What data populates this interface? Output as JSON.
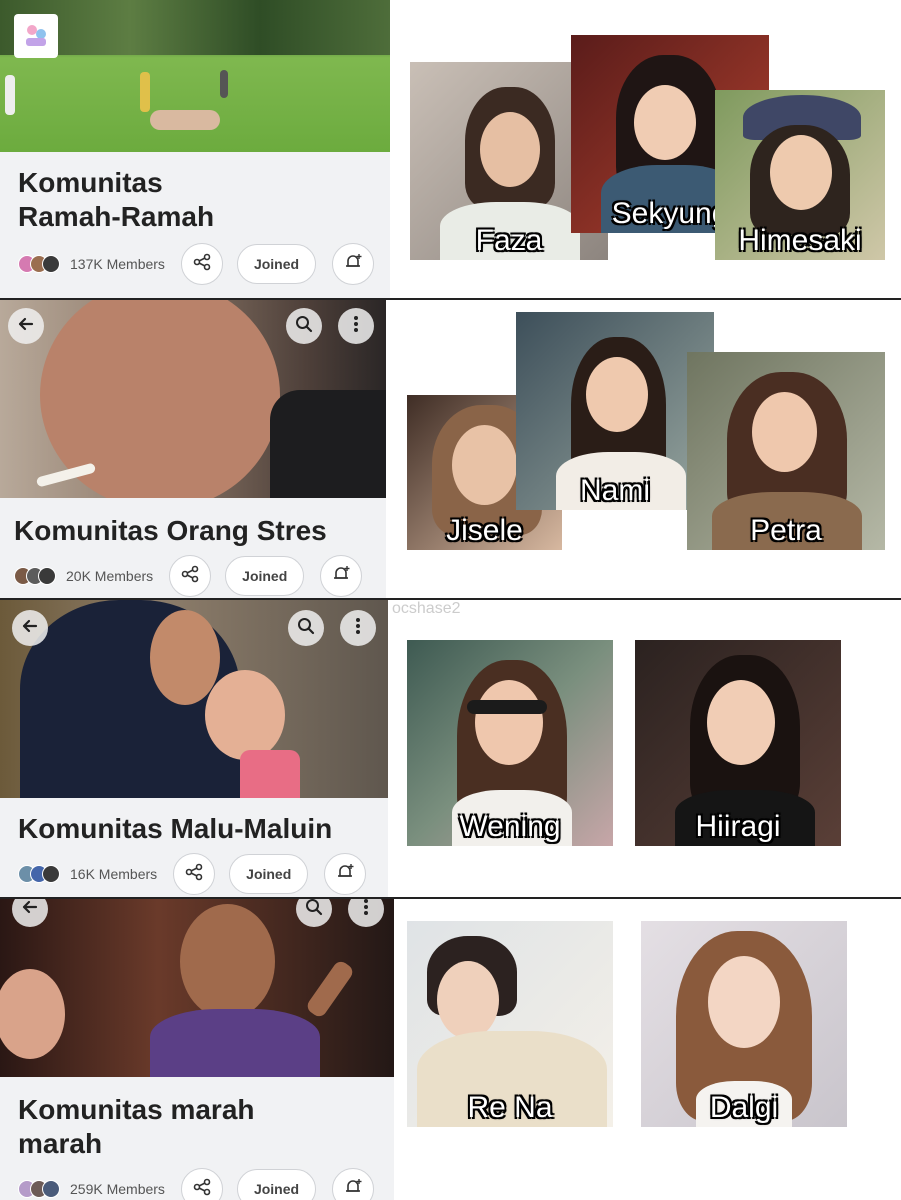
{
  "communities": [
    {
      "title": "Komunitas Ramah-Ramah",
      "members": "137K Members",
      "joined_label": "Joined",
      "girls": [
        "Faza",
        "Sekyung",
        "Himesaki"
      ]
    },
    {
      "title": "Komunitas Orang Stres",
      "members": "20K Members",
      "joined_label": "Joined",
      "girls": [
        "Jisele",
        "Nami",
        "Petra"
      ]
    },
    {
      "title": "Komunitas Malu-Maluin",
      "members": "16K Members",
      "joined_label": "Joined",
      "girls": [
        "Wening",
        "Hiiragi"
      ]
    },
    {
      "title": "Komunitas marah marah",
      "members": "259K Members",
      "joined_label": "Joined",
      "girls": [
        "Re Na",
        "Dalgi"
      ]
    }
  ],
  "watermark": "ocshase2",
  "icons": [
    "back-arrow-icon",
    "search-icon",
    "more-vertical-icon",
    "share-icon",
    "bell-plus-icon"
  ],
  "colors": {
    "divider": "#222222",
    "card_bg": "#f1f2f4",
    "name_text": "#ffffff"
  }
}
